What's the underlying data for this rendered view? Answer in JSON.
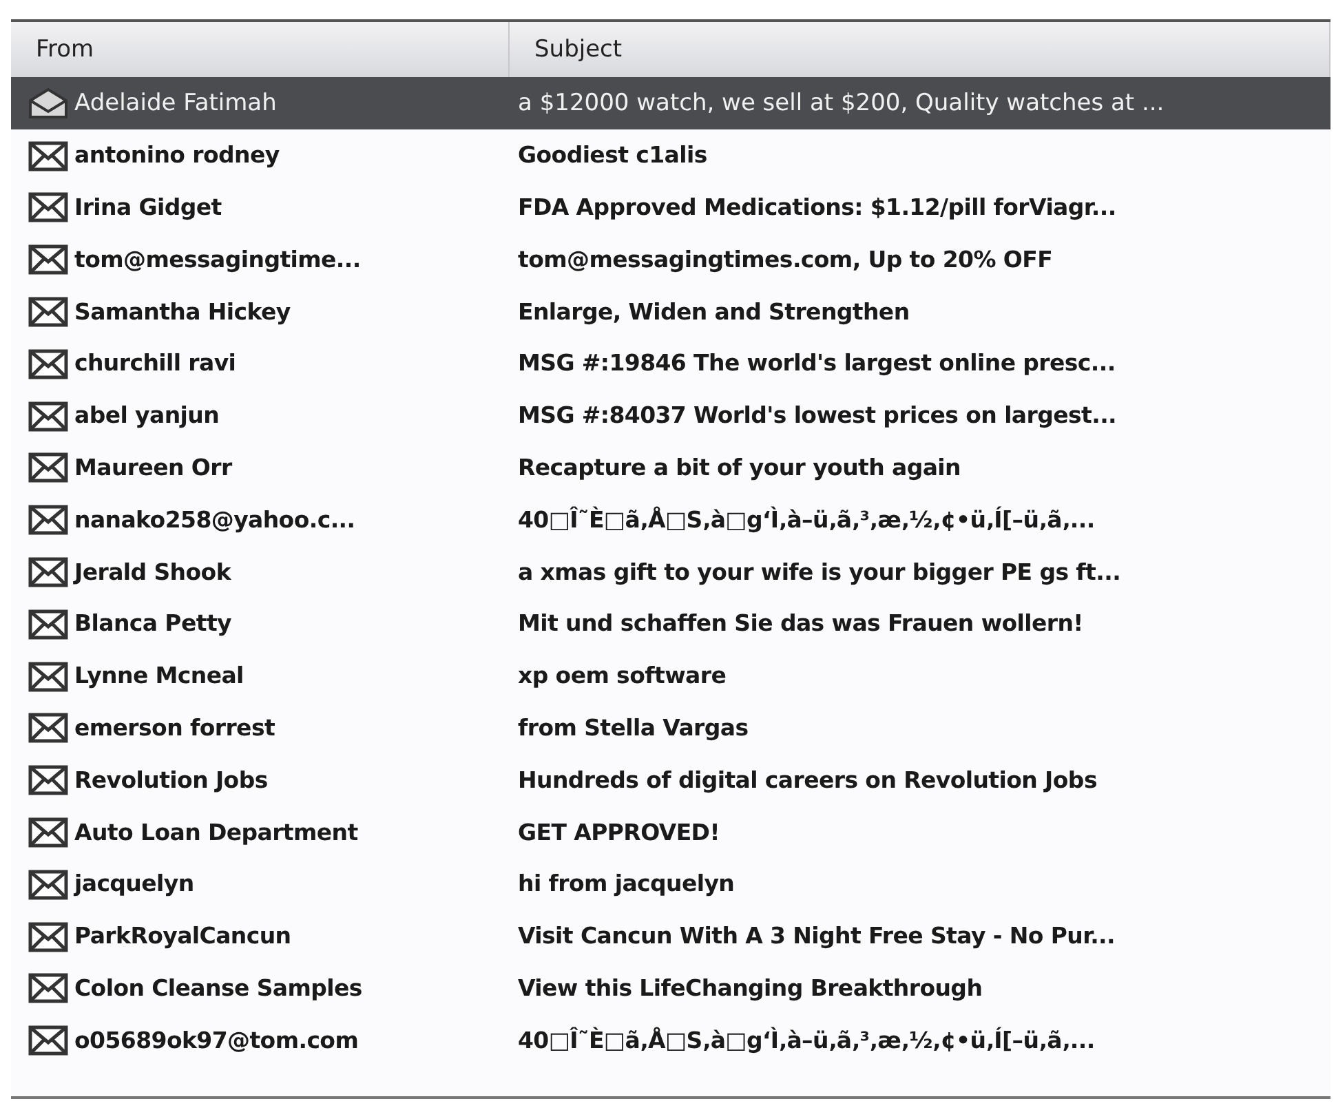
{
  "columns": [
    "From",
    "Subject"
  ],
  "messages": [
    {
      "from": "Adelaide Fatimah",
      "subject": "a $12000 watch, we sell at $200, Quality watches at ...",
      "selected": true,
      "unread": false
    },
    {
      "from": "antonino rodney",
      "subject": "Goodiest c1alis",
      "selected": false,
      "unread": true
    },
    {
      "from": "Irina Gidget",
      "subject": "FDA Approved Medications: $1.12/pill forViagr...",
      "selected": false,
      "unread": true
    },
    {
      "from": "tom@messagingtime...",
      "subject": "tom@messagingtimes.com, Up to 20% OFF",
      "selected": false,
      "unread": true
    },
    {
      "from": "Samantha Hickey",
      "subject": "Enlarge, Widen and Strengthen",
      "selected": false,
      "unread": true
    },
    {
      "from": "churchill ravi",
      "subject": "MSG #:19846 The world's largest online presc...",
      "selected": false,
      "unread": true
    },
    {
      "from": "abel yanjun",
      "subject": "MSG #:84037 World's lowest prices on largest...",
      "selected": false,
      "unread": true
    },
    {
      "from": "Maureen Orr",
      "subject": "Recapture a bit of your youth again",
      "selected": false,
      "unread": true
    },
    {
      "from": "nanako258@yahoo.c...",
      "subject": "40□Î˜È□ã‚Å□S‚à□g‘Ì‚à–ü‚ã‚³‚æ‚½‚¢•ü‚Í[–ü‚ã‚...",
      "selected": false,
      "unread": true
    },
    {
      "from": "Jerald Shook",
      "subject": "a xmas gift to your wife is your bigger PE gs ft...",
      "selected": false,
      "unread": true
    },
    {
      "from": "Blanca Petty",
      "subject": "Mit und schaffen Sie das was Frauen wollern!",
      "selected": false,
      "unread": true
    },
    {
      "from": "Lynne Mcneal",
      "subject": "xp oem software",
      "selected": false,
      "unread": true
    },
    {
      "from": "emerson forrest",
      "subject": "from Stella Vargas",
      "selected": false,
      "unread": true
    },
    {
      "from": "Revolution Jobs",
      "subject": "Hundreds of digital careers on Revolution Jobs",
      "selected": false,
      "unread": true
    },
    {
      "from": "Auto Loan Department",
      "subject": "GET APPROVED!",
      "selected": false,
      "unread": true
    },
    {
      "from": "jacquelyn",
      "subject": "hi from jacquelyn",
      "selected": false,
      "unread": true
    },
    {
      "from": "ParkRoyalCancun",
      "subject": "Visit Cancun With A 3 Night Free Stay - No Pur...",
      "selected": false,
      "unread": true
    },
    {
      "from": "Colon Cleanse Samples",
      "subject": "View this LifeChanging Breakthrough",
      "selected": false,
      "unread": true
    },
    {
      "from": "o05689ok97@tom.com",
      "subject": "40□Î˜È□ã‚Å□S‚à□g‘Ì‚à–ü‚ã‚³‚æ‚½‚¢•ü‚Í[–ü‚ã‚...",
      "selected": false,
      "unread": true
    }
  ]
}
